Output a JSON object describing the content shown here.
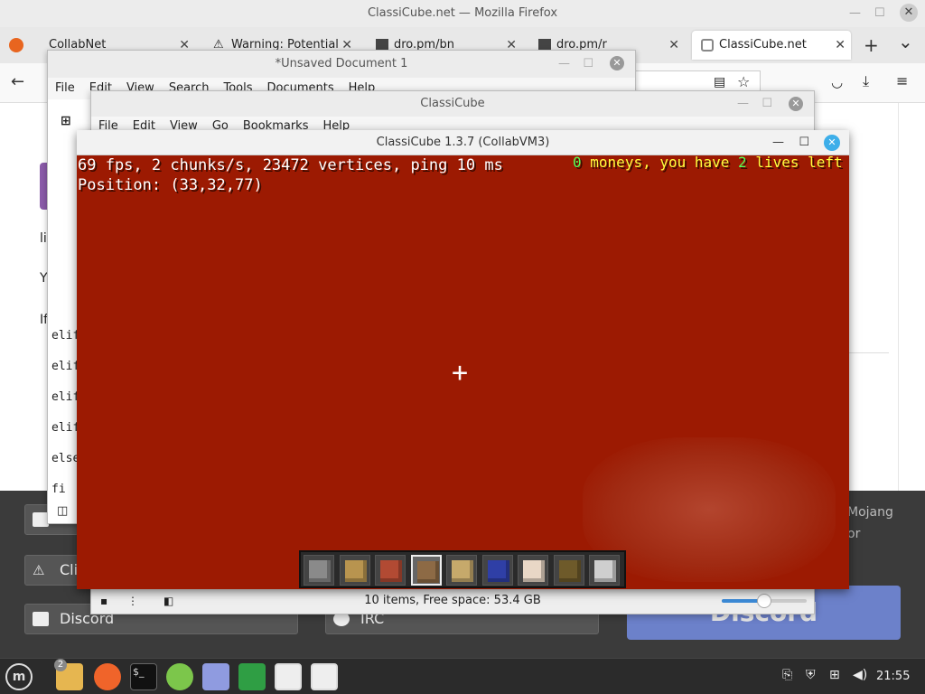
{
  "firefox": {
    "window_title": "ClassiCube.net — Mozilla Firefox",
    "tabs": [
      {
        "label": "CollabNet"
      },
      {
        "label": "Warning: Potential S"
      },
      {
        "label": "dro.pm/bn"
      },
      {
        "label": "dro.pm/r"
      },
      {
        "label": "ClassiCube.net"
      }
    ],
    "new_tab": "+",
    "tab_list": "⌄",
    "page_fragments": {
      "li": "li",
      "y": "Y",
      "if": "If"
    },
    "buttons": {
      "discord": "Discord",
      "irc": "IRC",
      "cli": "Cli",
      "discord_big": "Discord"
    },
    "credit_text_1": "Mojang",
    "credit_text_2": "or"
  },
  "text_editor": {
    "title": "*Unsaved Document 1",
    "menu": [
      "File",
      "Edit",
      "View",
      "Search",
      "Tools",
      "Documents",
      "Help"
    ],
    "code_lines": [
      "elif",
      "elif",
      "elif",
      "elif",
      "else",
      "fi"
    ]
  },
  "file_manager": {
    "title": "ClassiCube",
    "menu": [
      "File",
      "Edit",
      "View",
      "Go",
      "Bookmarks",
      "Help"
    ],
    "status": "10 items, Free space: 53.4 GB",
    "zoom_level": 0.5
  },
  "classicube": {
    "title": "ClassiCube 1.3.7 (CollabVM3)",
    "stats": "69 fps, 2 chunks/s, 23472 vertices, ping 10 ms",
    "position": "Position: (33,32,77)",
    "hud_right": {
      "moneys_count": "0",
      "moneys_text": "moneys, you have",
      "lives_count": "2",
      "lives_text": "lives left"
    },
    "crosshair": "+",
    "hotbar": [
      {
        "name": "stone",
        "color": "#8a8a8a"
      },
      {
        "name": "planks",
        "color": "#b8944f"
      },
      {
        "name": "bricks",
        "color": "#b24a33"
      },
      {
        "name": "wood-planks",
        "color": "#8d6a45"
      },
      {
        "name": "log",
        "color": "#c6a96b"
      },
      {
        "name": "blue-wool",
        "color": "#2f3fa6"
      },
      {
        "name": "cake",
        "color": "#e9d7c6"
      },
      {
        "name": "glowstone",
        "color": "#6e5a2a"
      },
      {
        "name": "slab",
        "color": "#cfcfcf"
      }
    ],
    "selected_slot": 3
  },
  "taskbar": {
    "badge": "2",
    "clock": "21:55"
  },
  "colors": {
    "sky_red": "#9c1a02",
    "hud_yellow": "#ffff3f",
    "hud_green": "#55ff55"
  }
}
